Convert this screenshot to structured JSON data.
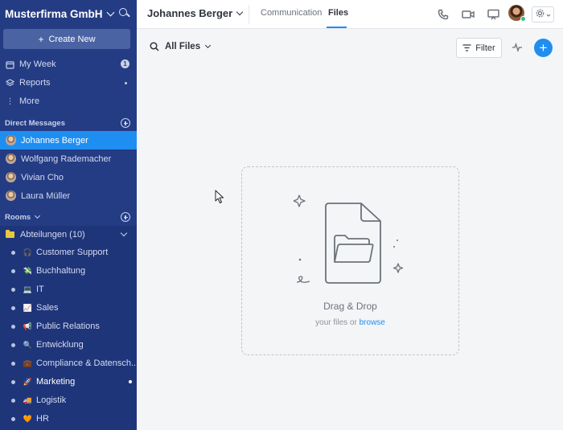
{
  "sidebar": {
    "workspace": "Musterfirma GmbH",
    "create_label": "Create New",
    "nav": [
      {
        "label": "My Week",
        "icon": "calendar-icon",
        "badge": "1"
      },
      {
        "label": "Reports",
        "icon": "layers-icon"
      },
      {
        "label": "More",
        "icon": "kebab-icon"
      }
    ],
    "direct_messages_title": "Direct Messages",
    "dms": [
      {
        "name": "Johannes Berger",
        "active": true
      },
      {
        "name": "Wolfgang Rademacher"
      },
      {
        "name": "Vivian Cho"
      },
      {
        "name": "Laura Müller"
      }
    ],
    "rooms_title": "Rooms",
    "room_group": "Abteilungen (10)",
    "rooms": [
      {
        "name": "Customer Support",
        "icon": "headphones-icon"
      },
      {
        "name": "Buchhaltung",
        "icon": "money-icon"
      },
      {
        "name": "IT",
        "icon": "computer-icon"
      },
      {
        "name": "Sales",
        "icon": "chart-icon"
      },
      {
        "name": "Public Relations",
        "icon": "megaphone-icon"
      },
      {
        "name": "Entwicklung",
        "icon": "magnifier-icon"
      },
      {
        "name": "Compliance & Datensch...",
        "icon": "briefcase-icon"
      },
      {
        "name": "Marketing",
        "icon": "rocket-icon",
        "unread": true
      },
      {
        "name": "Logistik",
        "icon": "truck-icon"
      },
      {
        "name": "HR",
        "icon": "heart-icon"
      }
    ]
  },
  "header": {
    "contact": "Johannes Berger",
    "tabs": [
      "Communication",
      "Files"
    ],
    "active_tab": "Files"
  },
  "toolbar": {
    "title": "All Files",
    "filter_label": "Filter"
  },
  "dropzone": {
    "title": "Drag & Drop",
    "subtitle_prefix": "your files or ",
    "browse_link": "browse"
  },
  "colors": {
    "sidebar_bg": "#243c84",
    "accent": "#1f8ef1",
    "online": "#2ec27e"
  }
}
